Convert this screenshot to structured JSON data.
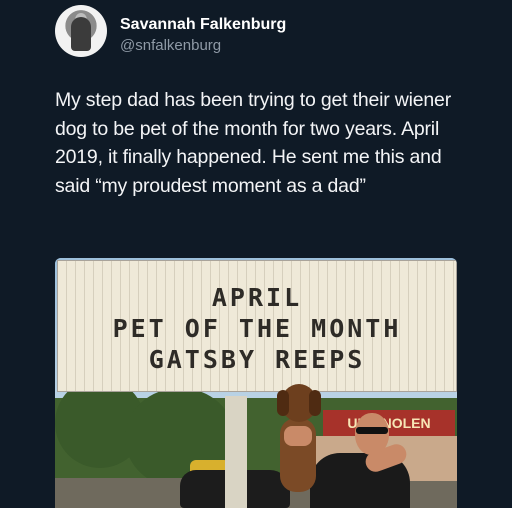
{
  "tweet": {
    "author": {
      "display_name": "Savannah Falkenburg",
      "handle": "@snfalkenburg",
      "avatar_icon": "avatar-image"
    },
    "text": "My step dad has been trying to get their wiener dog to be pet of the month for two years. April 2019, it finally happened. He sent me this and said “my proudest moment as a dad”",
    "photo": {
      "sign_lines": [
        "APRIL",
        "PET OF THE MONTH",
        "GATSBY REEPS"
      ],
      "store_sign": "UILY NOLEN"
    }
  },
  "colors": {
    "background": "#0f1a26",
    "text": "#f3f4f6",
    "handle": "#8f9aa6"
  }
}
